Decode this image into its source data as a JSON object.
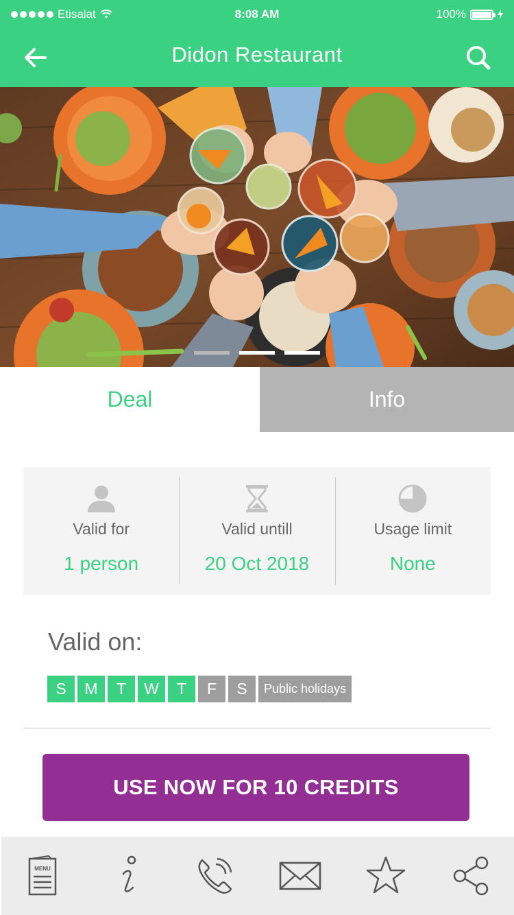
{
  "status_bar": {
    "carrier": "Etisalat",
    "time": "8:08 AM",
    "battery": "100%"
  },
  "header": {
    "title": "Didon Restaurant",
    "back_icon": "back-arrow-icon",
    "search_icon": "search-icon"
  },
  "hero": {
    "page_count": 3,
    "active_page": 1
  },
  "tabs": [
    {
      "label": "Deal",
      "selected": true
    },
    {
      "label": "Info",
      "selected": false
    }
  ],
  "stats": [
    {
      "icon": "person-icon",
      "label": "Valid for",
      "value": "1 person"
    },
    {
      "icon": "hourglass-icon",
      "label": "Valid untill",
      "value": "20 Oct 2018"
    },
    {
      "icon": "pie-chart-icon",
      "label": "Usage limit",
      "value": "None"
    }
  ],
  "valid_on": {
    "title": "Valid on:",
    "days": [
      {
        "label": "S",
        "active": true
      },
      {
        "label": "M",
        "active": true
      },
      {
        "label": "T",
        "active": true
      },
      {
        "label": "W",
        "active": true
      },
      {
        "label": "T",
        "active": true
      },
      {
        "label": "F",
        "active": false
      },
      {
        "label": "S",
        "active": false
      }
    ],
    "public_holidays": {
      "label": "Public holidays",
      "active": false
    }
  },
  "cta": {
    "label": "USE NOW FOR 10 CREDITS"
  },
  "toolbar": {
    "menu_icon_text": "MENU",
    "items": [
      "menu-icon",
      "info-icon",
      "phone-icon",
      "mail-icon",
      "star-icon",
      "share-icon"
    ]
  },
  "colors": {
    "brand_green": "#3ad282",
    "cta_purple": "#932e95",
    "inactive_gray": "#9e9e9e",
    "tab_gray": "#b4b4b4"
  }
}
